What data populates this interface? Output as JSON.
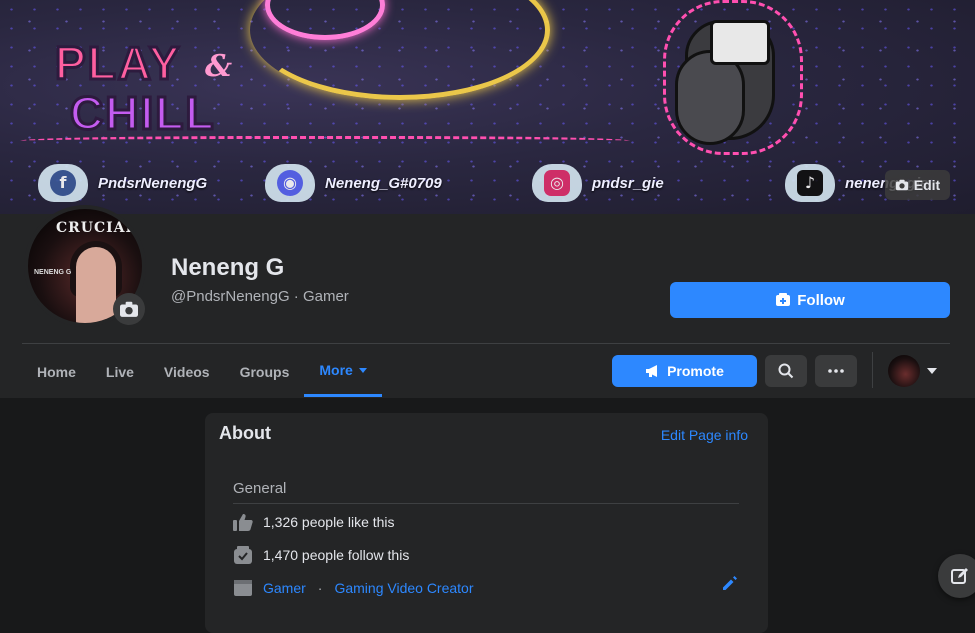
{
  "cover": {
    "edit_label": "Edit",
    "social": [
      {
        "platform": "facebook-icon",
        "handle": "PndsrNenengG",
        "color": "#3b5998"
      },
      {
        "platform": "discord-icon",
        "handle": "Neneng_G#0709",
        "color": "#5865f2"
      },
      {
        "platform": "instagram-icon",
        "handle": "pndsr_gie",
        "color": "#e1306c"
      },
      {
        "platform": "tiktok-icon",
        "handle": "neneng_gie",
        "color": "#111111"
      }
    ],
    "art": {
      "line1": "PLAY",
      "amp": "&",
      "line2": "CHILL"
    }
  },
  "profile": {
    "name": "Neneng G",
    "subtitle": "@PndsrNenengG · Gamer",
    "avatar_text": "CRUCIAL",
    "avatar_subtext": "NENENG G",
    "follow_label": "Follow"
  },
  "nav": {
    "tabs": [
      {
        "label": "Home"
      },
      {
        "label": "Live"
      },
      {
        "label": "Videos"
      },
      {
        "label": "Groups"
      },
      {
        "label": "More",
        "active": true
      }
    ],
    "promote_label": "Promote"
  },
  "about": {
    "title": "About",
    "edit_label": "Edit Page info",
    "section": "General",
    "likes": "1,326 people like this",
    "follows": "1,470 people follow this",
    "category_1": "Gamer",
    "category_sep": "·",
    "category_2": "Gaming Video Creator"
  },
  "colors": {
    "accent": "#2d88ff",
    "bg": "#18191a",
    "card": "#242526"
  }
}
